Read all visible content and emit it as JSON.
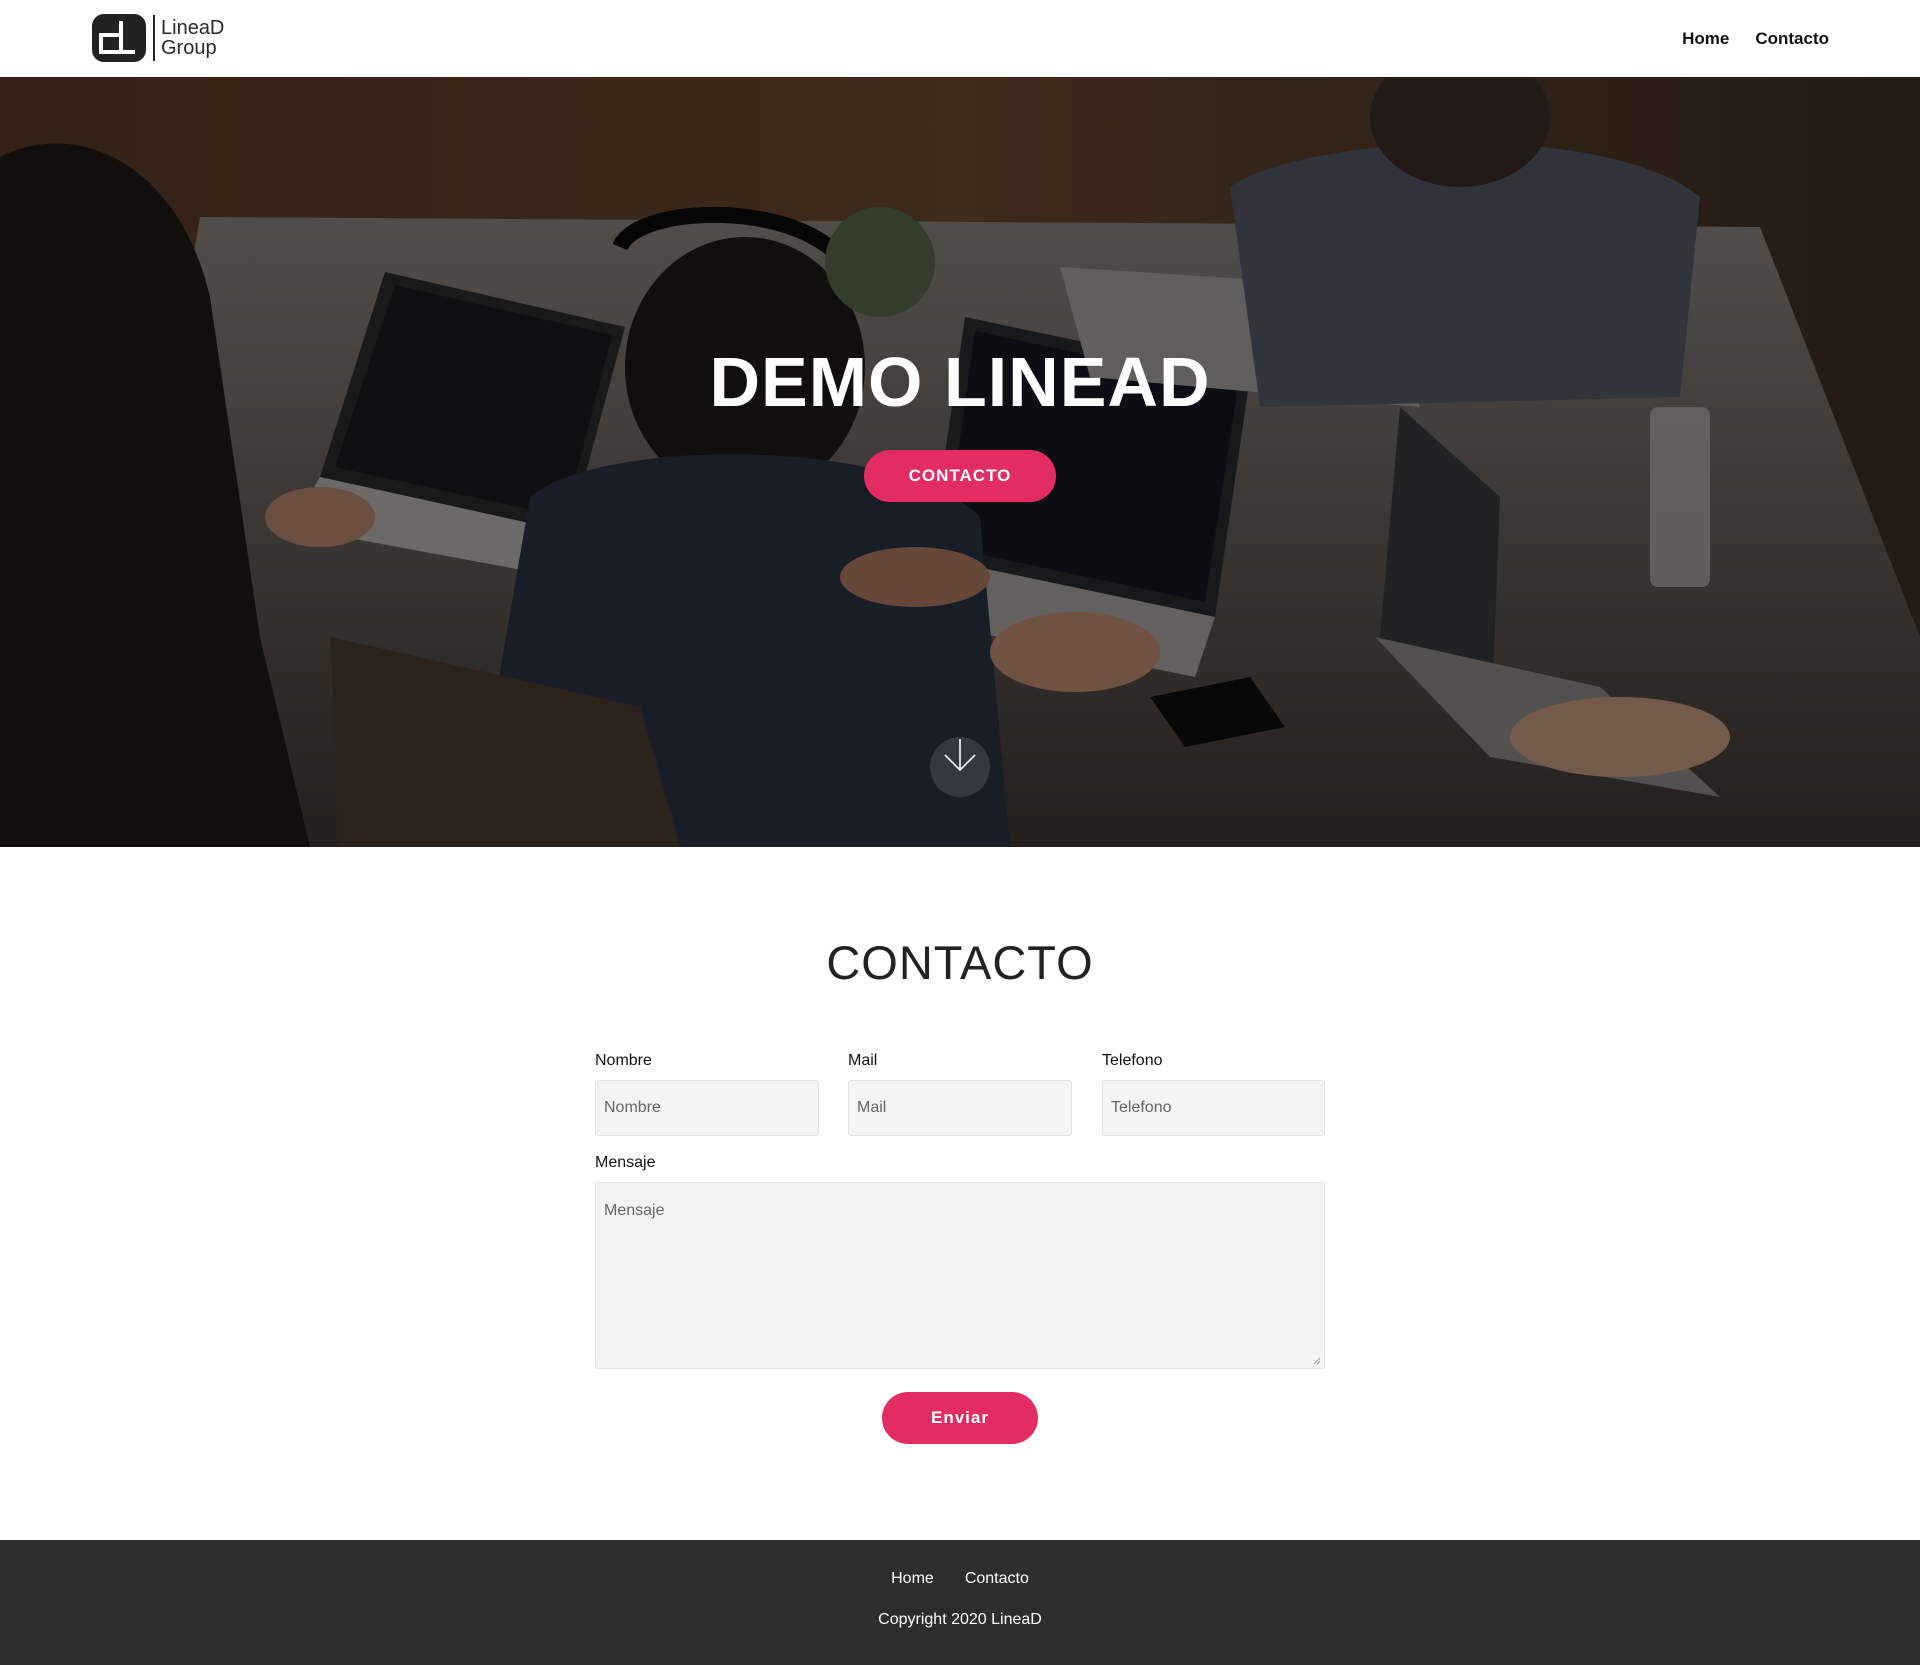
{
  "header": {
    "logo_line1": "LineaD",
    "logo_line2": "Group",
    "nav": [
      "Home",
      "Contacto"
    ]
  },
  "hero": {
    "title": "DEMO LINEAD",
    "button_label": "CONTACTO",
    "scroll_icon": "arrow-down-icon"
  },
  "contact": {
    "title": "CONTACTO",
    "fields": [
      {
        "label": "Nombre",
        "placeholder": "Nombre"
      },
      {
        "label": "Mail",
        "placeholder": "Mail"
      },
      {
        "label": "Telefono",
        "placeholder": "Telefono"
      }
    ],
    "message": {
      "label": "Mensaje",
      "placeholder": "Mensaje"
    },
    "submit_label": "Enviar"
  },
  "footer": {
    "nav": [
      "Home",
      "Contacto"
    ],
    "copyright": "Copyright 2020 LineaD"
  },
  "colors": {
    "accent": "#e42c64",
    "footer_bg": "#2d2d2d",
    "field_bg": "#f4f4f4"
  }
}
